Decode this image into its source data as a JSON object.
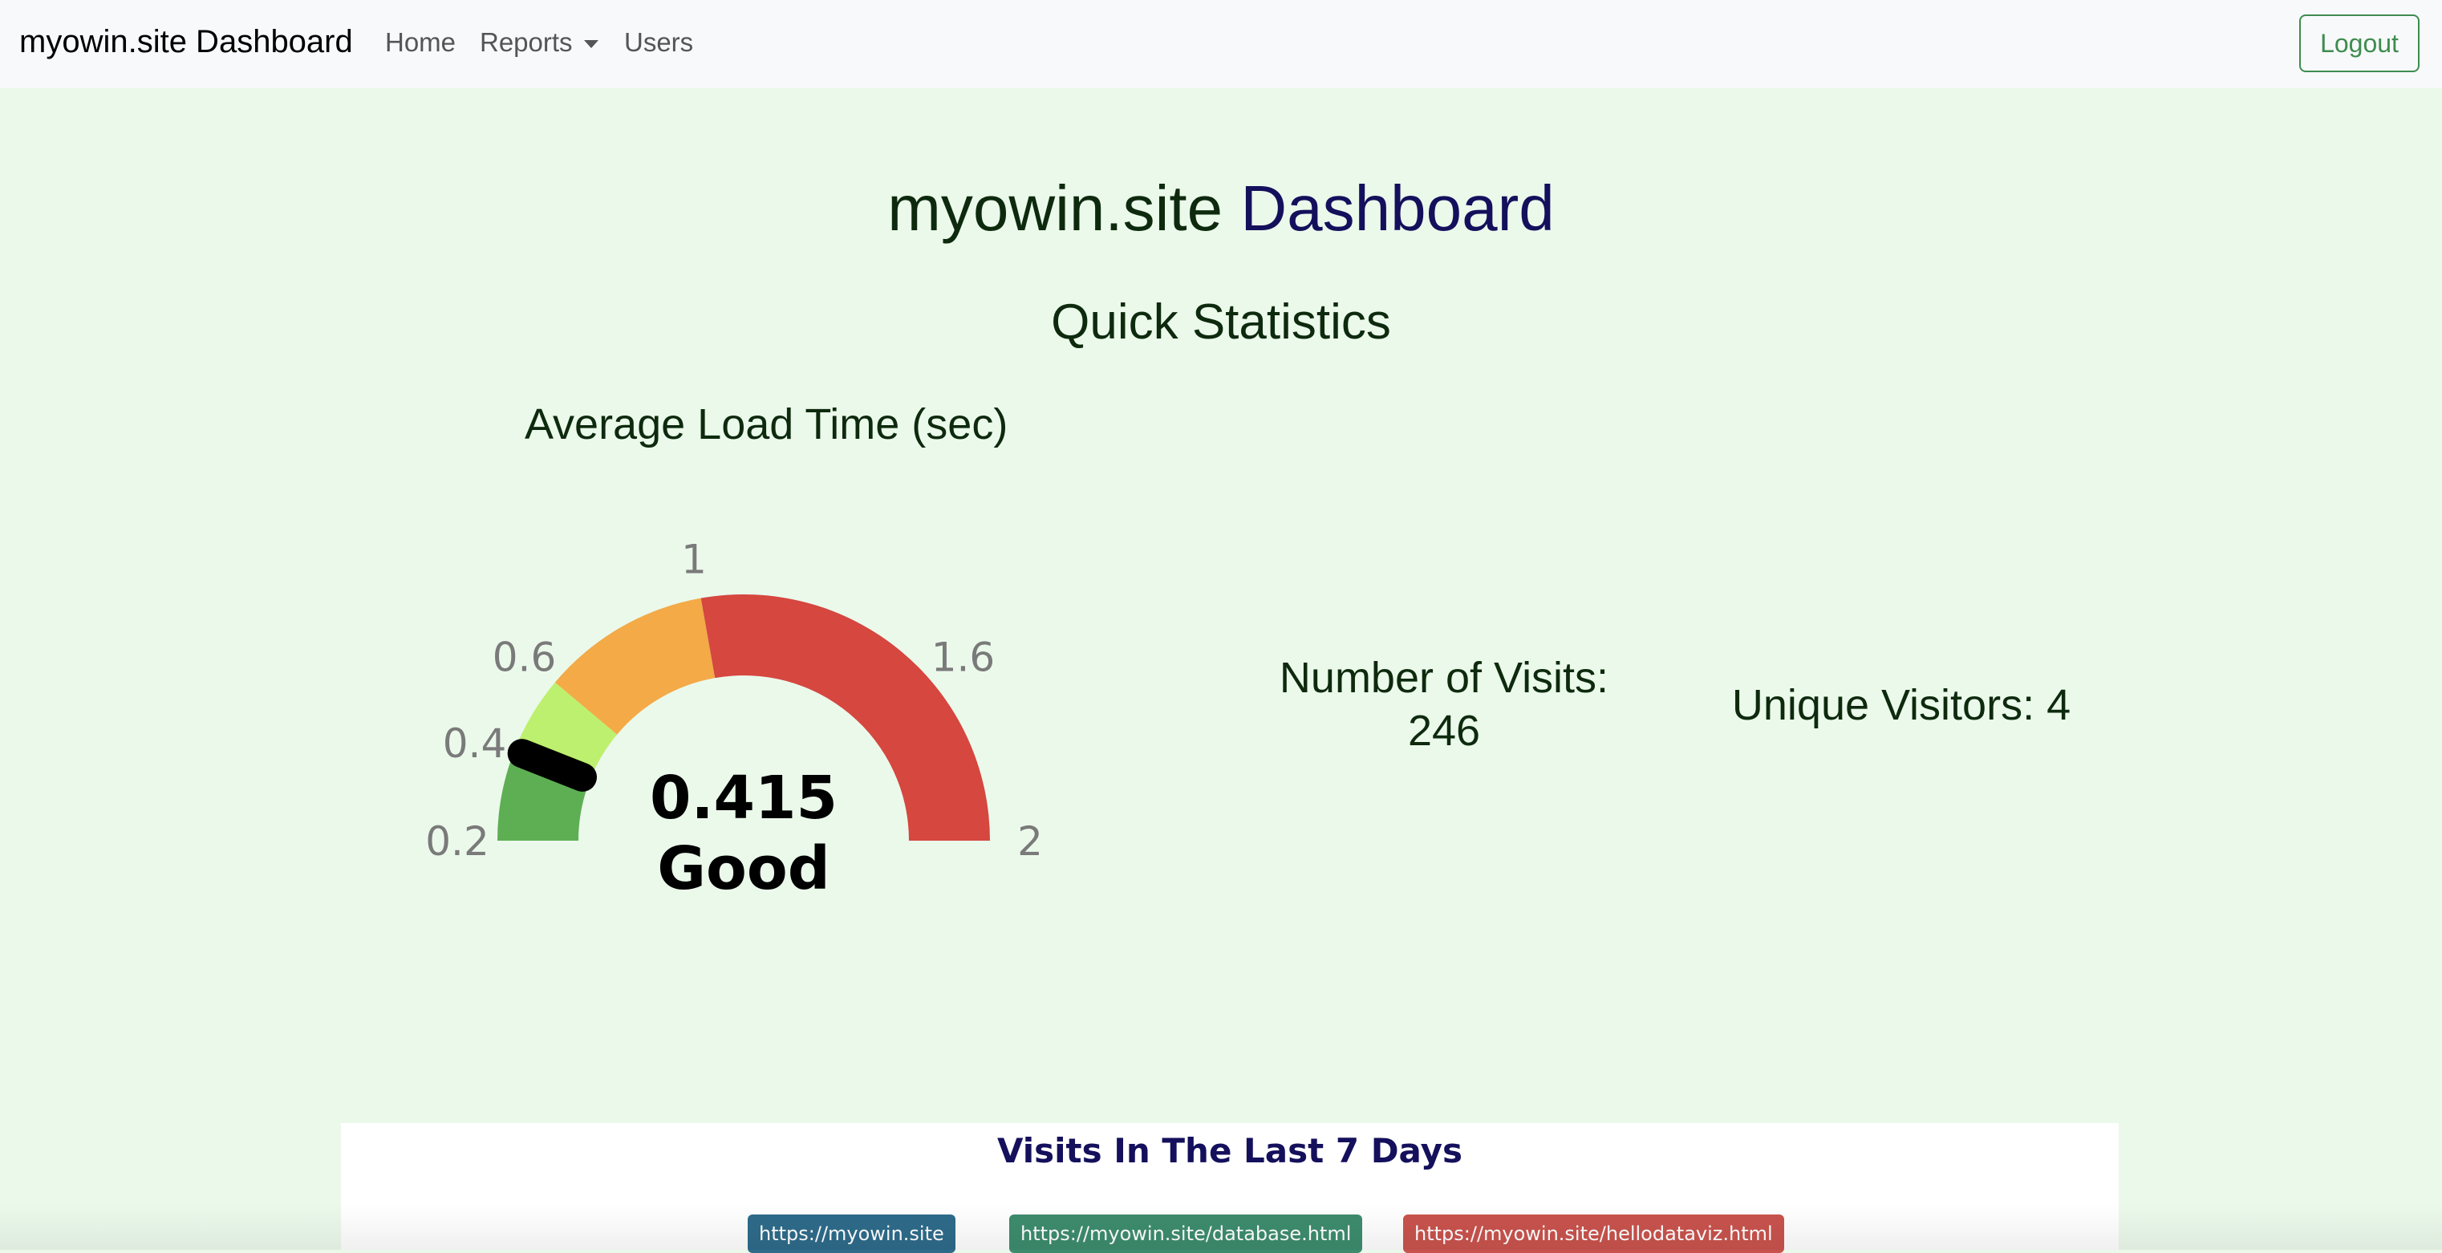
{
  "navbar": {
    "brand": "myowin.site Dashboard",
    "links": [
      {
        "label": "Home"
      },
      {
        "label": "Reports"
      },
      {
        "label": "Users"
      }
    ],
    "logout_label": "Logout"
  },
  "page": {
    "title_part1": "myowin.site",
    "title_part2": "Dashboard",
    "section_title": "Quick Statistics"
  },
  "gauge": {
    "title": "Average Load Time (sec)",
    "value": 0.415,
    "value_label": "0.415",
    "rating": "Good",
    "min": 0.2,
    "max": 2,
    "bands": [
      {
        "from": 0.2,
        "to": 0.4,
        "color": "#5eaf53"
      },
      {
        "from": 0.4,
        "to": 0.6,
        "color": "#bdf06e"
      },
      {
        "from": 0.6,
        "to": 1,
        "color": "#f3aa47"
      },
      {
        "from": 1,
        "to": 2,
        "color": "#d5473f"
      }
    ],
    "ticks": [
      {
        "value": 0.2,
        "label": "0.2"
      },
      {
        "value": 0.4,
        "label": "0.4"
      },
      {
        "value": 0.6,
        "label": "0.6"
      },
      {
        "value": 1,
        "label": "1"
      },
      {
        "value": 1.6,
        "label": "1.6"
      },
      {
        "value": 2,
        "label": "2"
      }
    ],
    "needle_color": "#000000",
    "tick_color": "#7a7a7a"
  },
  "stats": {
    "visits_label": "Number of Visits:",
    "visits_value": "246",
    "unique_text": "Unique Visitors: 4"
  },
  "chart": {
    "title": "Visits In The Last 7 Days",
    "legend": [
      {
        "label": "https://myowin.site",
        "color": "#2e6b8a"
      },
      {
        "label": "https://myowin.site/database.html",
        "color": "#3d8c6e"
      },
      {
        "label": "https://myowin.site/hellodataviz.html",
        "color": "#c9534d"
      }
    ]
  }
}
